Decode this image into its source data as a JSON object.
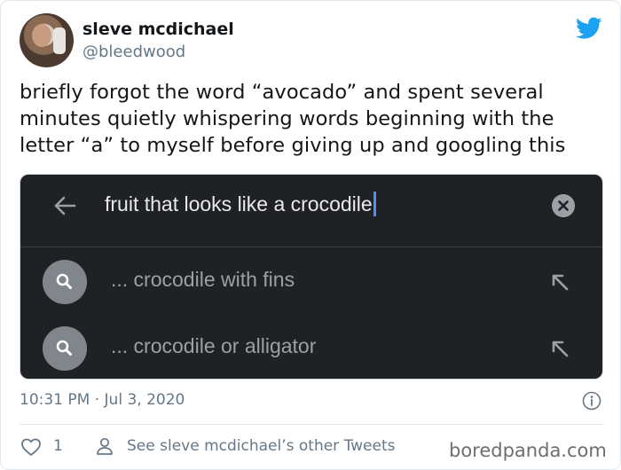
{
  "user": {
    "display_name": "sleve mcdichael",
    "handle": "@bleedwood"
  },
  "tweet": {
    "text": "briefly forgot the word “avocado” and spent several minutes quietly whispering words beginning with the letter “a” to myself before giving up and googling this"
  },
  "screenshot": {
    "query": "fruit that looks like a crocodile",
    "suggestions": [
      {
        "text": "... crocodile with fins"
      },
      {
        "text": "... crocodile or alligator"
      }
    ]
  },
  "meta": {
    "timestamp": "10:31 PM · Jul 3, 2020",
    "like_count": "1",
    "other_tweets_label": "See sleve mcdichael’s other Tweets"
  },
  "watermark": "boredpanda.com",
  "colors": {
    "twitter_blue": "#1da1f2",
    "dark_bg": "#202124",
    "cursor_blue": "#4d8ef7"
  },
  "icons": [
    "twitter-bird-icon",
    "back-arrow-icon",
    "clear-icon",
    "search-icon",
    "fill-query-arrow-icon",
    "info-icon",
    "heart-icon",
    "person-icon"
  ]
}
